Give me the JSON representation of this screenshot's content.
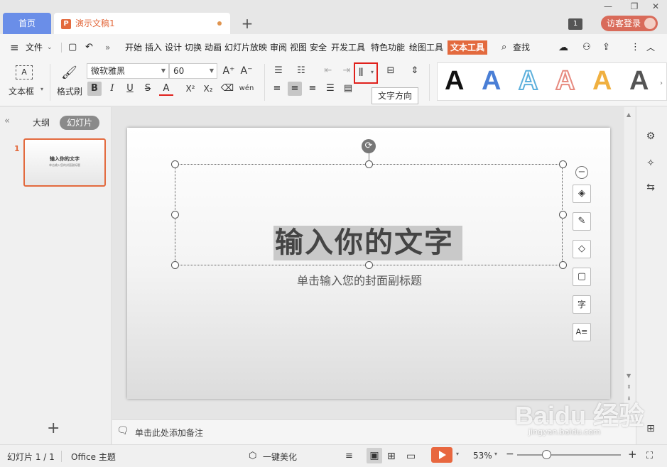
{
  "tabs": {
    "home": "首页",
    "doc_icon": "P",
    "doc_name": "演示文稿1",
    "new_tab": "+"
  },
  "window": {
    "minimize": "—",
    "restore": "❐",
    "close": "✕",
    "notification_count": "1",
    "guest_login": "访客登录"
  },
  "menubar": {
    "hamburger": "≡",
    "file_label": "文件",
    "more": "»",
    "items": [
      "开始",
      "插入",
      "设计",
      "切换",
      "动画",
      "幻灯片放映",
      "审阅",
      "视图",
      "安全",
      "开发工具",
      "特色功能",
      "绘图工具"
    ],
    "active_item": "文本工具",
    "search": "查找"
  },
  "toolbar": {
    "textbox_label": "文本框",
    "format_painter_label": "格式刷",
    "font_name": "微软雅黑",
    "font_size": "60",
    "bold": "B",
    "italic": "I",
    "underline": "U",
    "strike": "S",
    "font_color": "A",
    "superscript": "X²",
    "subscript": "X₂",
    "clear": "⌫",
    "phonetic": "wén",
    "grow": "A⁺",
    "shrink": "A⁻",
    "text_direction_tooltip": "文字方向",
    "style_letters": [
      "A",
      "A",
      "A",
      "A",
      "A",
      "A"
    ]
  },
  "leftpanel": {
    "collapse": "«",
    "outline_tab": "大纲",
    "slides_tab": "幻灯片",
    "slide_number": "1",
    "thumb_title": "输入你的文字",
    "thumb_subtitle": "单击输入您的封面副标题",
    "add_slide": "+"
  },
  "slide": {
    "title": "输入你的文字",
    "subtitle": "单击输入您的封面副标题",
    "rotate_icon": "⟳",
    "collapse_tools": "−"
  },
  "notes": {
    "placeholder": "单击此处添加备注"
  },
  "statusbar": {
    "slide_count": "幻灯片 1 / 1",
    "theme": "Office 主题",
    "beautify": "一键美化",
    "zoom": "53%",
    "zoom_minus": "−",
    "zoom_plus": "+"
  },
  "watermark": {
    "brand": "Baidu 经验",
    "url": "jingyan.baidu.com"
  },
  "colors": {
    "accent_orange": "#e36a3e",
    "home_tab_blue": "#6a8ee8",
    "highlight_red": "#e0211c"
  }
}
